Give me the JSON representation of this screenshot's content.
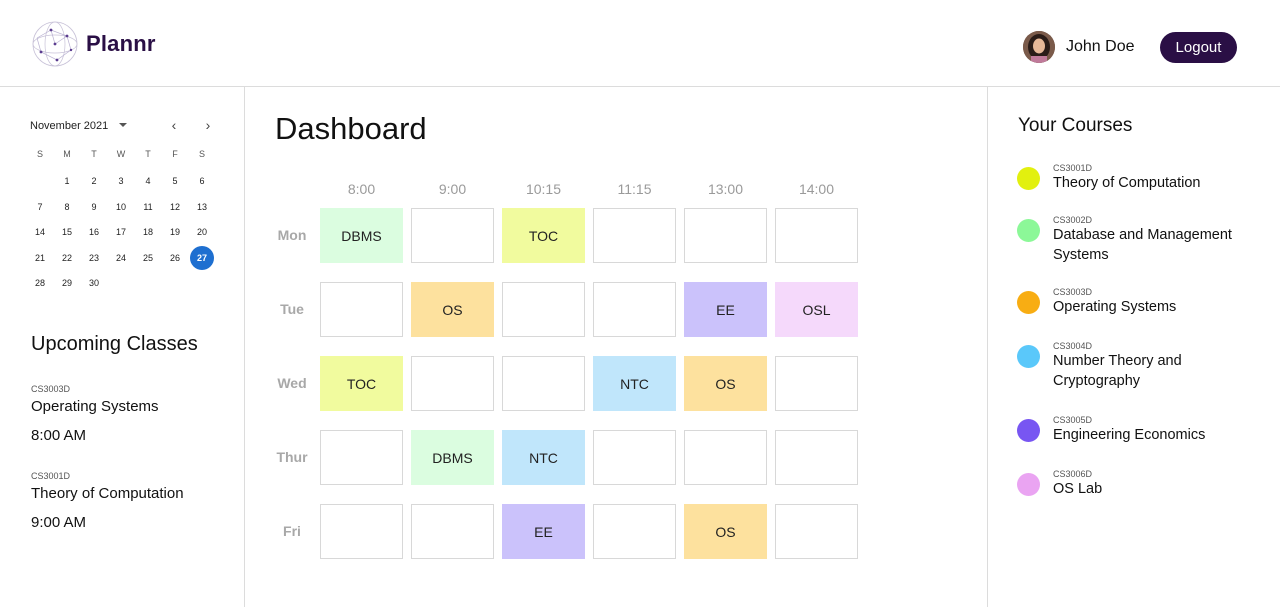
{
  "header": {
    "logo_text": "Plannr",
    "username": "John Doe",
    "logout_label": "Logout"
  },
  "calendar": {
    "month_label": "November 2021",
    "weekdays": [
      "S",
      "M",
      "T",
      "W",
      "T",
      "F",
      "S"
    ],
    "first_weekday_index": 1,
    "days_in_month": 30,
    "selected_day": 27,
    "selected_color": "#1e6fd0"
  },
  "upcoming": {
    "title": "Upcoming Classes",
    "items": [
      {
        "code": "CS3003D",
        "name": "Operating Systems",
        "time": "8:00 AM"
      },
      {
        "code": "CS3001D",
        "name": "Theory of Computation",
        "time": "9:00 AM"
      }
    ]
  },
  "dashboard": {
    "title": "Dashboard",
    "times": [
      "8:00",
      "9:00",
      "10:15",
      "11:15",
      "13:00",
      "14:00"
    ],
    "days": [
      "Mon",
      "Tue",
      "Wed",
      "Thur",
      "Fri"
    ],
    "schedule": [
      [
        "DBMS",
        "",
        "TOC",
        "",
        "",
        ""
      ],
      [
        "",
        "OS",
        "",
        "",
        "EE",
        "OSL"
      ],
      [
        "TOC",
        "",
        "",
        "NTC",
        "OS",
        ""
      ],
      [
        "",
        "DBMS",
        "NTC",
        "",
        "",
        ""
      ],
      [
        "",
        "",
        "EE",
        "",
        "OS",
        ""
      ]
    ],
    "cell_colors": {
      "DBMS": "#dbfde0",
      "TOC": "#f1fb9e",
      "OS": "#fde19e",
      "EE": "#cbc2fb",
      "OSL": "#f5d9fb",
      "NTC": "#c0e6fb"
    }
  },
  "courses": {
    "title": "Your Courses",
    "items": [
      {
        "code": "CS3001D",
        "name": "Theory of Computation",
        "color": "#e2f00f"
      },
      {
        "code": "CS3002D",
        "name": "Database and Management Systems",
        "color": "#8cf898"
      },
      {
        "code": "CS3003D",
        "name": "Operating Systems",
        "color": "#f8ad13"
      },
      {
        "code": "CS3004D",
        "name": "Number Theory and Cryptography",
        "color": "#5ac8fa"
      },
      {
        "code": "CS3005D",
        "name": "Engineering Economics",
        "color": "#7856f2"
      },
      {
        "code": "CS3006D",
        "name": "OS Lab",
        "color": "#eaa4f2"
      }
    ]
  }
}
